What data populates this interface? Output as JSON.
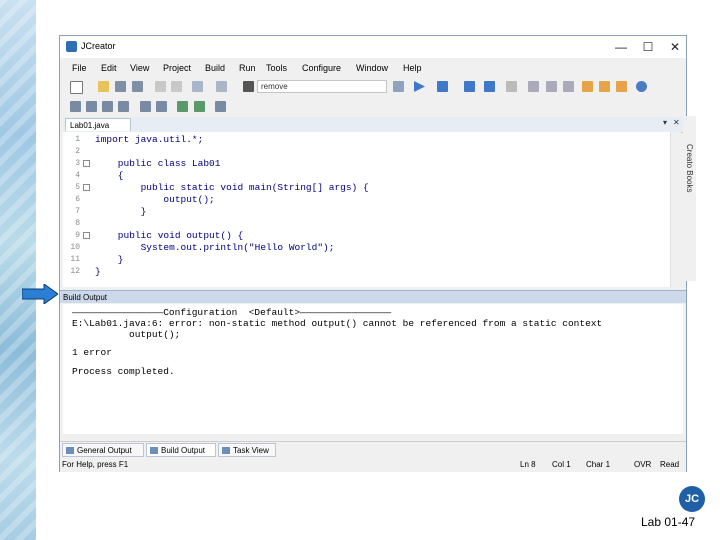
{
  "window": {
    "title": "JCreator",
    "minimize": "—",
    "maximize": "☐",
    "close": "✕"
  },
  "menu": [
    "File",
    "Edit",
    "View",
    "Project",
    "Build",
    "Run",
    "Tools",
    "Configure",
    "Window",
    "Help"
  ],
  "toolbar": {
    "search_value": "remove"
  },
  "editor": {
    "tab_label": "Lab01.java",
    "lines": [
      {
        "n": "1",
        "code": "import java.util.*;"
      },
      {
        "n": "2",
        "code": ""
      },
      {
        "n": "3",
        "code": "    public class Lab01"
      },
      {
        "n": "4",
        "code": "    {"
      },
      {
        "n": "5",
        "code": "        public static void main(String[] args) {"
      },
      {
        "n": "6",
        "code": "            output();"
      },
      {
        "n": "7",
        "code": "        }"
      },
      {
        "n": "8",
        "code": ""
      },
      {
        "n": "9",
        "code": "    public void output() {"
      },
      {
        "n": "10",
        "code": "        System.out.println(\"Hello World\");"
      },
      {
        "n": "11",
        "code": "    }"
      },
      {
        "n": "12",
        "code": "}"
      }
    ]
  },
  "side_panel": {
    "label": "Creato Books"
  },
  "output": {
    "title": "Build Output",
    "lines": [
      "————————————————Configuration  <Default>————————————————",
      "E:\\Lab01.java:6: error: non-static method output() cannot be referenced from a static context",
      "          output();",
      "1 error",
      "Process completed."
    ]
  },
  "bottom_tabs": [
    "General Output",
    "Build Output",
    "Task View"
  ],
  "status": {
    "help": "For Help, press F1",
    "ln": "Ln 8",
    "col": "Col 1",
    "char": "Char 1",
    "ovr": "OVR",
    "read": "Read"
  },
  "slide": {
    "page_label": "Lab 01-47",
    "logo_text": "JC"
  }
}
